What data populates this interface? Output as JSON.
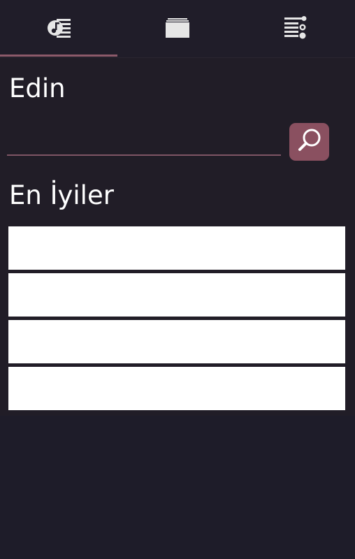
{
  "tabs": [
    {
      "name": "music-library-icon"
    },
    {
      "name": "albums-icon"
    },
    {
      "name": "playlist-settings-icon"
    }
  ],
  "search": {
    "title": "Edin",
    "value": "",
    "placeholder": ""
  },
  "top": {
    "title": "En İyiler",
    "items": [
      "",
      "",
      "",
      ""
    ]
  },
  "colors": {
    "background": "#1f1d29",
    "accent": "#8a5060",
    "underline": "#7e5565",
    "item_background": "#ffffff"
  }
}
